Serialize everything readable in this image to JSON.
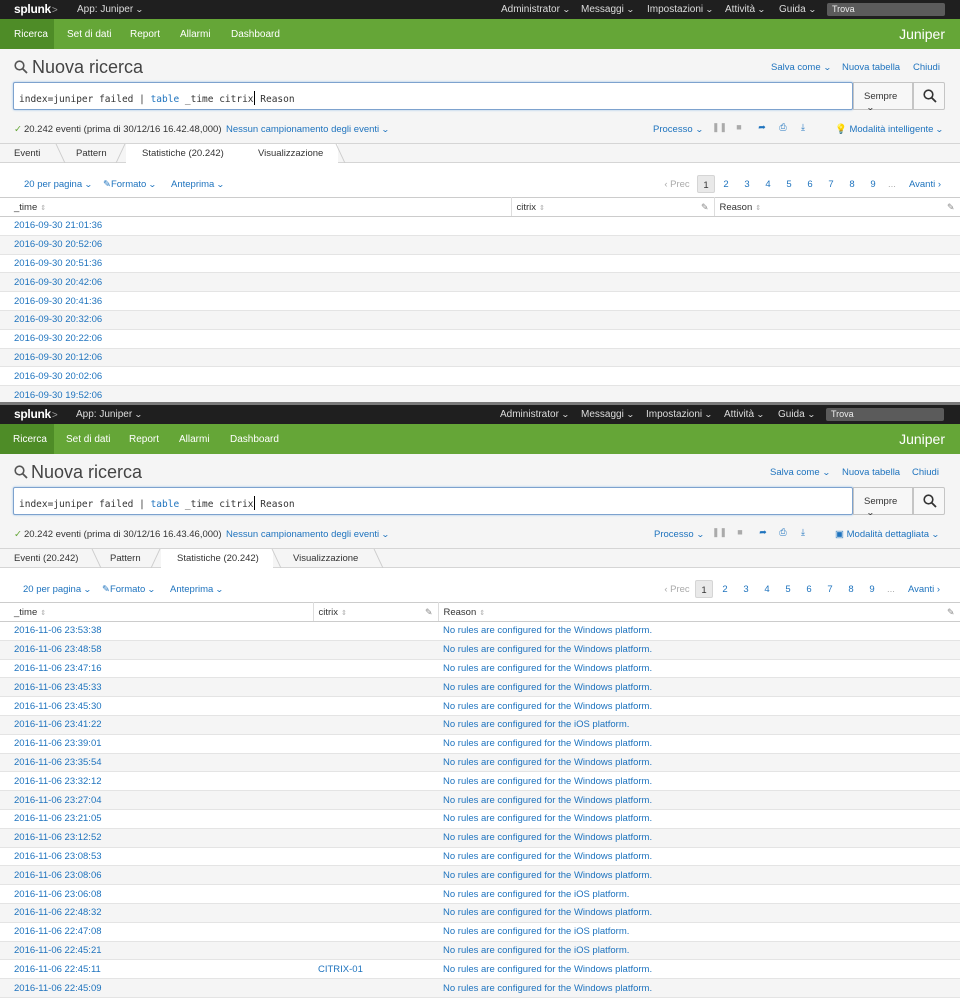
{
  "panels": [
    {
      "topbar": {
        "logo": "splunk",
        "logo_suffix": ">",
        "app": "App: Juniper",
        "menu": [
          "Administrator",
          "Messaggi",
          "Impostazioni",
          "Attività",
          "Guida"
        ],
        "find_placeholder": "Trova"
      },
      "nav": {
        "items": [
          "Ricerca",
          "Set di dati",
          "Report",
          "Allarmi",
          "Dashboard"
        ],
        "brand": "Juniper"
      },
      "title": "Nuova ricerca",
      "links": {
        "save": "Salva come",
        "new_table": "Nuova tabella",
        "close": "Chiudi"
      },
      "search": {
        "p1": "index=juniper failed ",
        "pipe": "|",
        "cmd": " table",
        "p2": " _time citrix",
        "p3": " Reason"
      },
      "time_range": "Sempre",
      "status": {
        "events": "20.242 eventi (prima di 30/12/16 16.42.48,000)",
        "sampling": "Nessun campionamento degli eventi"
      },
      "job": "Processo",
      "mode": "Modalità intelligente",
      "tabs": [
        "Eventi",
        "Pattern",
        "Statistiche (20.242)",
        "Visualizzazione"
      ],
      "controls": {
        "per_page": "20 per pagina",
        "format": "Formato",
        "preview": "Anteprima"
      },
      "pager": {
        "prev": "‹ Prec",
        "pages": [
          "1",
          "2",
          "3",
          "4",
          "5",
          "6",
          "7",
          "8",
          "9"
        ],
        "dots": "...",
        "next": "Avanti ›"
      },
      "columns": [
        "_time",
        "citrix",
        "Reason"
      ],
      "rows": [
        [
          "2016-09-30 21:01:36",
          "",
          ""
        ],
        [
          "2016-09-30 20:52:06",
          "",
          ""
        ],
        [
          "2016-09-30 20:51:36",
          "",
          ""
        ],
        [
          "2016-09-30 20:42:06",
          "",
          ""
        ],
        [
          "2016-09-30 20:41:36",
          "",
          ""
        ],
        [
          "2016-09-30 20:32:06",
          "",
          ""
        ],
        [
          "2016-09-30 20:22:06",
          "",
          ""
        ],
        [
          "2016-09-30 20:12:06",
          "",
          ""
        ],
        [
          "2016-09-30 20:02:06",
          "",
          ""
        ],
        [
          "2016-09-30 19:52:06",
          "",
          ""
        ]
      ]
    },
    {
      "topbar": {
        "logo": "splunk",
        "logo_suffix": ">",
        "app": "App: Juniper",
        "menu": [
          "Administrator",
          "Messaggi",
          "Impostazioni",
          "Attività",
          "Guida"
        ],
        "find_placeholder": "Trova"
      },
      "nav": {
        "items": [
          "Ricerca",
          "Set di dati",
          "Report",
          "Allarmi",
          "Dashboard"
        ],
        "brand": "Juniper"
      },
      "title": "Nuova ricerca",
      "links": {
        "save": "Salva come",
        "new_table": "Nuova tabella",
        "close": "Chiudi"
      },
      "search": {
        "p1": "index=juniper failed ",
        "pipe": "|",
        "cmd": " table",
        "p2": " _time citrix",
        "p3": " Reason"
      },
      "time_range": "Sempre",
      "status": {
        "events": "20.242 eventi (prima di 30/12/16 16.43.46,000)",
        "sampling": "Nessun campionamento degli eventi"
      },
      "job": "Processo",
      "mode": "Modalità dettagliata",
      "tabs": [
        "Eventi (20.242)",
        "Pattern",
        "Statistiche (20.242)",
        "Visualizzazione"
      ],
      "controls": {
        "per_page": "20 per pagina",
        "format": "Formato",
        "preview": "Anteprima"
      },
      "pager": {
        "prev": "‹ Prec",
        "pages": [
          "1",
          "2",
          "3",
          "4",
          "5",
          "6",
          "7",
          "8",
          "9"
        ],
        "dots": "...",
        "next": "Avanti ›"
      },
      "columns": [
        "_time",
        "citrix",
        "Reason"
      ],
      "rows": [
        [
          "2016-11-06 23:53:38",
          "",
          "No rules are configured for the Windows platform."
        ],
        [
          "2016-11-06 23:48:58",
          "",
          "No rules are configured for the Windows platform."
        ],
        [
          "2016-11-06 23:47:16",
          "",
          "No rules are configured for the Windows platform."
        ],
        [
          "2016-11-06 23:45:33",
          "",
          "No rules are configured for the Windows platform."
        ],
        [
          "2016-11-06 23:45:30",
          "",
          "No rules are configured for the Windows platform."
        ],
        [
          "2016-11-06 23:41:22",
          "",
          "No rules are configured for the iOS platform."
        ],
        [
          "2016-11-06 23:39:01",
          "",
          "No rules are configured for the Windows platform."
        ],
        [
          "2016-11-06 23:35:54",
          "",
          "No rules are configured for the Windows platform."
        ],
        [
          "2016-11-06 23:32:12",
          "",
          "No rules are configured for the Windows platform."
        ],
        [
          "2016-11-06 23:27:04",
          "",
          "No rules are configured for the Windows platform."
        ],
        [
          "2016-11-06 23:21:05",
          "",
          "No rules are configured for the Windows platform."
        ],
        [
          "2016-11-06 23:12:52",
          "",
          "No rules are configured for the Windows platform."
        ],
        [
          "2016-11-06 23:08:53",
          "",
          "No rules are configured for the Windows platform."
        ],
        [
          "2016-11-06 23:08:06",
          "",
          "No rules are configured for the Windows platform."
        ],
        [
          "2016-11-06 23:06:08",
          "",
          "No rules are configured for the iOS platform."
        ],
        [
          "2016-11-06 22:48:32",
          "",
          "No rules are configured for the Windows platform."
        ],
        [
          "2016-11-06 22:47:08",
          "",
          "No rules are configured for the iOS platform."
        ],
        [
          "2016-11-06 22:45:21",
          "",
          "No rules are configured for the iOS platform."
        ],
        [
          "2016-11-06 22:45:11",
          "CITRIX-01",
          "No rules are configured for the Windows platform."
        ],
        [
          "2016-11-06 22:45:09",
          "",
          "No rules are configured for the Windows platform."
        ]
      ]
    }
  ]
}
